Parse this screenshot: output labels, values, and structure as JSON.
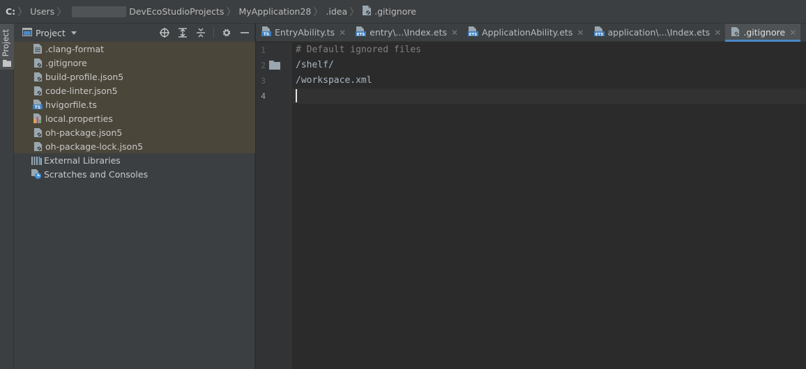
{
  "breadcrumb": {
    "drive": "C:",
    "items": [
      "Users",
      "DevEcoStudioProjects",
      "MyApplication28",
      ".idea",
      ".gitignore"
    ]
  },
  "toolstrip": {
    "project_label": "Project"
  },
  "project_panel": {
    "title": "Project",
    "tools": [
      "locate-icon",
      "expand-all-icon",
      "collapse-all-icon",
      "gear-icon",
      "minimize-icon"
    ],
    "files": [
      {
        "label": ".clang-format",
        "icon": "text-file-icon"
      },
      {
        "label": ".gitignore",
        "icon": "ignore-file-icon"
      },
      {
        "label": "build-profile.json5",
        "icon": "json5-file-icon"
      },
      {
        "label": "code-linter.json5",
        "icon": "json5-file-icon"
      },
      {
        "label": "hvigorfile.ts",
        "icon": "ts-file-icon"
      },
      {
        "label": "local.properties",
        "icon": "properties-file-icon"
      },
      {
        "label": "oh-package.json5",
        "icon": "json5-file-icon"
      },
      {
        "label": "oh-package-lock.json5",
        "icon": "json5-file-icon"
      }
    ],
    "roots": [
      {
        "label": "External Libraries",
        "icon": "libraries-icon"
      },
      {
        "label": "Scratches and Consoles",
        "icon": "scratches-icon"
      }
    ]
  },
  "tabs": [
    {
      "label": "EntryAbility.ts",
      "icon": "ts-file-icon",
      "active": false
    },
    {
      "label": "entry\\...\\Index.ets",
      "icon": "ets-file-icon",
      "active": false
    },
    {
      "label": "ApplicationAbility.ets",
      "icon": "ets-file-icon",
      "active": false
    },
    {
      "label": "application\\...\\Index.ets",
      "icon": "ets-file-icon",
      "active": false
    },
    {
      "label": ".gitignore",
      "icon": "ignore-file-icon",
      "active": true
    }
  ],
  "editor": {
    "line_numbers": [
      "1",
      "2",
      "3",
      "4"
    ],
    "lines": [
      "# Default ignored files",
      "/shelf/",
      "/workspace.xml",
      ""
    ],
    "current_line": 4
  },
  "colors": {
    "panel_bg": "#3c3f41",
    "editor_bg": "#2b2b2b",
    "highlight_row": "#4b463a",
    "active_tab_underline": "#4a88c7",
    "comment": "#808080",
    "code_text": "#a9b7c6"
  }
}
